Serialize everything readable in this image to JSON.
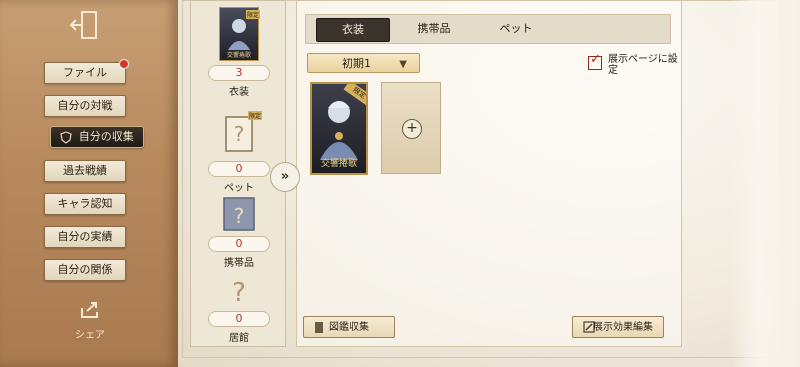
{
  "sidebar": {
    "exit_icon": "exit-door-icon",
    "items": [
      {
        "label": "ファイル",
        "has_dot": true
      },
      {
        "label": "自分の対戦"
      },
      {
        "label": "自分の収集",
        "active": true
      },
      {
        "label": "過去戦績"
      },
      {
        "label": "キャラ認知"
      },
      {
        "label": "自分の実績"
      },
      {
        "label": "自分の関係"
      }
    ],
    "share_label": "シェア"
  },
  "categories": [
    {
      "badge": "限定",
      "card_name": "交響捲歌",
      "count": "3",
      "label": "衣装"
    },
    {
      "badge": "限定",
      "count": "0",
      "label": "ペット"
    },
    {
      "count": "0",
      "label": "携帯品"
    },
    {
      "count": "0",
      "label": "居館"
    }
  ],
  "tabs": [
    {
      "label": "衣装",
      "active": true
    },
    {
      "label": "携帯品"
    },
    {
      "label": "ペット"
    }
  ],
  "filter": {
    "selected": "初期1"
  },
  "showpage": {
    "label": "展示ページに設定",
    "checked": true
  },
  "costume_card": {
    "badge": "限定",
    "name": "交響捲歌"
  },
  "buttons": {
    "collection": "図鑑収集",
    "edit_effect": "展示効果編集"
  },
  "colors": {
    "accent_red": "#b3362c",
    "active_tab": "#3a342d",
    "sidebar_brown": "#b8895d"
  }
}
